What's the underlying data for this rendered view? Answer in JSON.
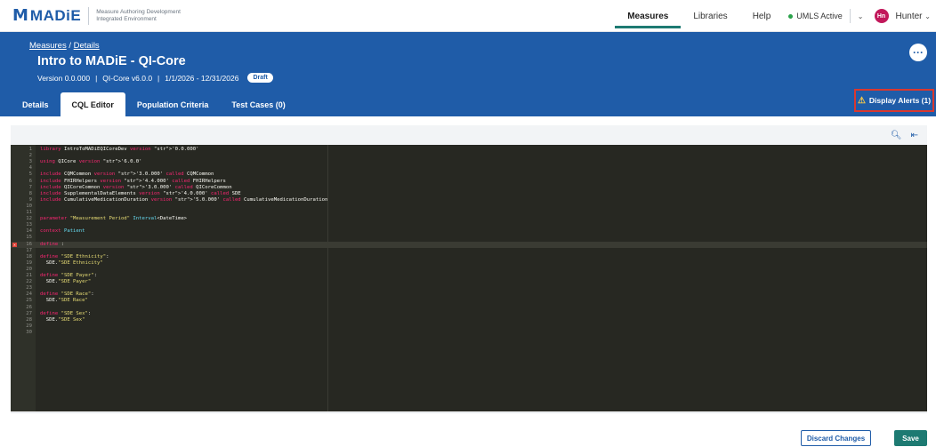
{
  "topbar": {
    "logo_mark": "M",
    "logo_text": "MADiE",
    "logo_sub_line1": "Measure Authoring Development",
    "logo_sub_line2": "Integrated Environment",
    "nav": [
      "Measures",
      "Libraries",
      "Help"
    ],
    "active_nav": "Measures",
    "umls_status": "UMLS Active",
    "avatar_initials": "Hn",
    "user_name": "Hunter"
  },
  "header": {
    "breadcrumb": [
      "Measures",
      "Details"
    ],
    "title": "Intro to MADiE - QI-Core",
    "version": "Version 0.0.000",
    "model": "QI-Core v6.0.0",
    "period": "1/1/2026 - 12/31/2026",
    "status": "Draft",
    "more_glyph": "···",
    "tabs": [
      "Details",
      "CQL Editor",
      "Population Criteria",
      "Test Cases (0)"
    ],
    "active_tab": "CQL Editor",
    "alerts_label": "Display Alerts (1)"
  },
  "editor": {
    "lines": [
      {
        "n": "1",
        "t": "library IntroToMADiEQICoreDev version '0.0.000'"
      },
      {
        "n": "2",
        "t": ""
      },
      {
        "n": "3",
        "t": "using QICore version '6.0.0'"
      },
      {
        "n": "4",
        "t": ""
      },
      {
        "n": "5",
        "t": "include CQMCommon version '3.0.000' called CQMCommon"
      },
      {
        "n": "6",
        "t": "include FHIRHelpers version '4.4.000' called FHIRHelpers"
      },
      {
        "n": "7",
        "t": "include QICoreCommon version '3.0.000' called QICoreCommon"
      },
      {
        "n": "8",
        "t": "include SupplementalDataElements version '4.0.000' called SDE"
      },
      {
        "n": "9",
        "t": "include CumulativeMedicationDuration version '5.0.000' called CumulativeMedicationDuration"
      },
      {
        "n": "10",
        "t": ""
      },
      {
        "n": "11",
        "t": ""
      },
      {
        "n": "12",
        "t": "parameter \"Measurement Period\" Interval<DateTime>"
      },
      {
        "n": "13",
        "t": ""
      },
      {
        "n": "14",
        "t": "context Patient"
      },
      {
        "n": "15",
        "t": ""
      },
      {
        "n": "16",
        "t": "define :"
      },
      {
        "n": "17",
        "t": ""
      },
      {
        "n": "18",
        "t": "define \"SDE Ethnicity\":"
      },
      {
        "n": "19",
        "t": "  SDE.\"SDE Ethnicity\""
      },
      {
        "n": "20",
        "t": ""
      },
      {
        "n": "21",
        "t": "define \"SDE Payer\":"
      },
      {
        "n": "22",
        "t": "  SDE.\"SDE Payer\""
      },
      {
        "n": "23",
        "t": ""
      },
      {
        "n": "24",
        "t": "define \"SDE Race\":"
      },
      {
        "n": "25",
        "t": "  SDE.\"SDE Race\""
      },
      {
        "n": "26",
        "t": ""
      },
      {
        "n": "27",
        "t": "define \"SDE Sex\":"
      },
      {
        "n": "28",
        "t": "  SDE.\"SDE Sex\""
      },
      {
        "n": "29",
        "t": ""
      },
      {
        "n": "30",
        "t": ""
      }
    ],
    "error_line": "16",
    "error_marker": "×"
  },
  "footer": {
    "discard_label": "Discard Changes",
    "save_label": "Save"
  }
}
